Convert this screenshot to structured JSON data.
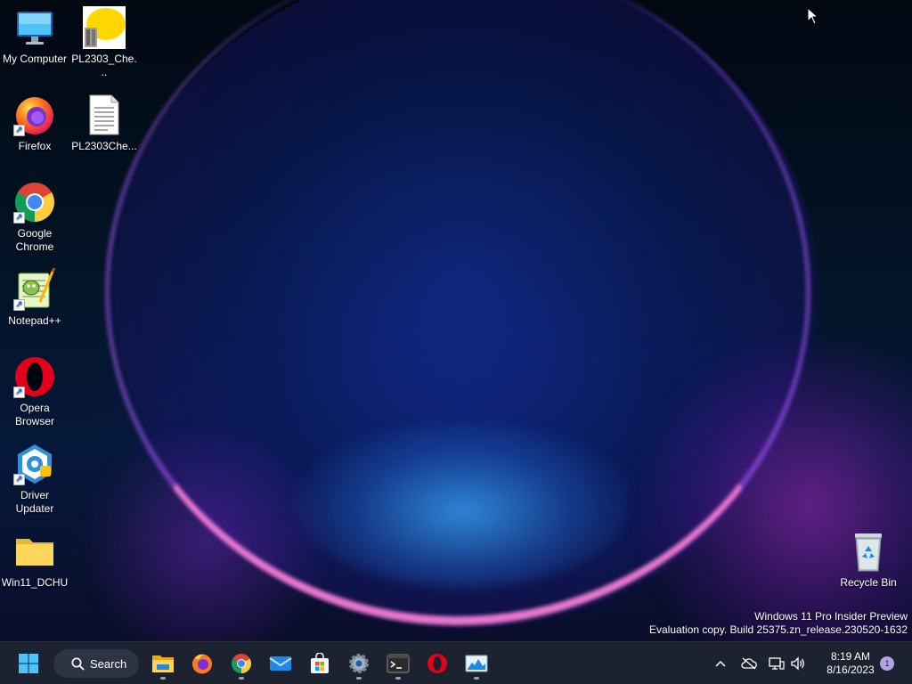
{
  "desktop": {
    "icons": [
      {
        "label": "My Computer",
        "icon": "monitor-icon"
      },
      {
        "label": "PL2303_Che...",
        "icon": "pl2303-app-icon"
      },
      {
        "label": "Firefox",
        "icon": "firefox-icon"
      },
      {
        "label": "PL2303Che...",
        "icon": "text-document-icon"
      },
      {
        "label": "Google Chrome",
        "icon": "chrome-icon"
      },
      {
        "label": "Notepad++",
        "icon": "notepadpp-icon"
      },
      {
        "label": "Opera Browser",
        "icon": "opera-icon"
      },
      {
        "label": "Driver Updater",
        "icon": "driver-updater-icon"
      },
      {
        "label": "Win11_DCHU",
        "icon": "folder-icon"
      },
      {
        "label": "Recycle Bin",
        "icon": "recycle-bin-icon"
      }
    ]
  },
  "watermark": {
    "line1": "Windows 11 Pro Insider Preview",
    "line2": "Evaluation copy. Build 25375.zn_release.230520-1632"
  },
  "taskbar": {
    "search_label": "Search",
    "pinned": [
      {
        "name": "file-explorer-icon",
        "running": true
      },
      {
        "name": "firefox-icon",
        "running": false
      },
      {
        "name": "chrome-icon",
        "running": true
      },
      {
        "name": "mail-icon",
        "running": false
      },
      {
        "name": "microsoft-store-icon",
        "running": false
      },
      {
        "name": "settings-icon",
        "running": true
      },
      {
        "name": "terminal-icon",
        "running": true
      },
      {
        "name": "opera-icon",
        "running": false
      },
      {
        "name": "photos-icon",
        "running": true
      }
    ],
    "clock": {
      "time": "8:19 AM",
      "date": "8/16/2023"
    },
    "notification_count": "1"
  },
  "colors": {
    "taskbar_bg": "#1d2230",
    "accent": "#0078d4"
  }
}
